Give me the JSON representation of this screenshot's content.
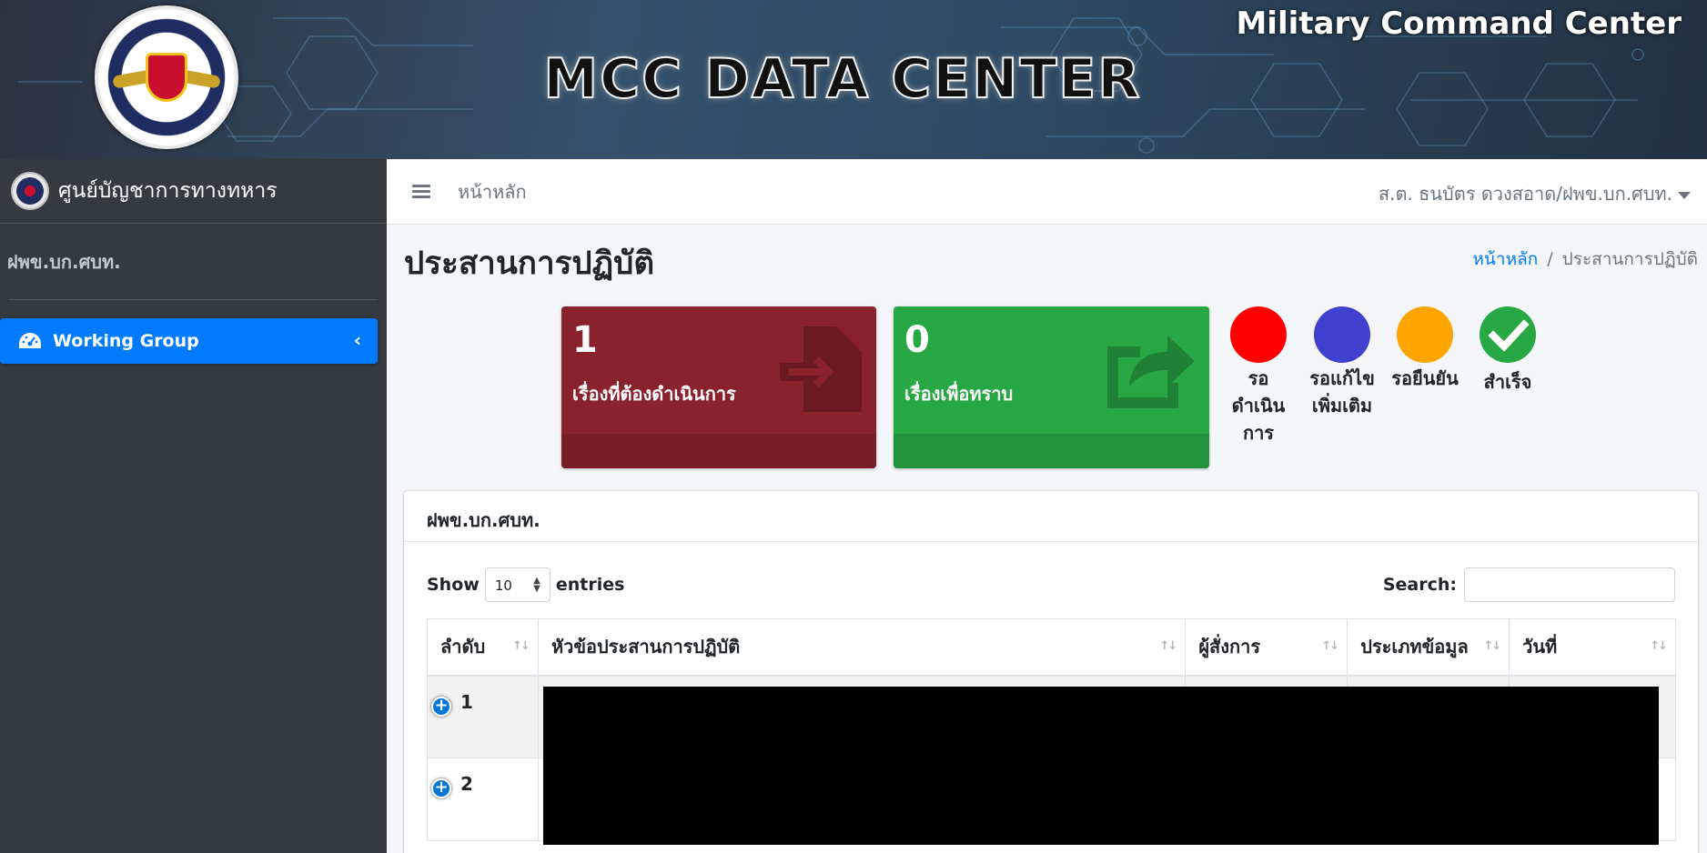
{
  "banner": {
    "title": "MCC DATA CENTER",
    "subtitle": "Military Command Center",
    "logo_icon": "military-command-center-seal"
  },
  "sidebar": {
    "brand_text": "ศูนย์บัญชาการทางทหาร",
    "user_unit": "ฝพข.บก.ศบท.",
    "nav": [
      {
        "label": "Working Group",
        "icon": "tachometer-icon",
        "active": true
      }
    ]
  },
  "topnav": {
    "home_link": "หน้าหลัก",
    "user_name": "ส.ต. ธนบัตร ดวงสอาด/ฝพข.บก.ศบท."
  },
  "page": {
    "title": "ประสานการปฏิบัติ",
    "breadcrumb": {
      "home": "หน้าหลัก",
      "current": "ประสานการปฏิบัติ",
      "separator": "/"
    }
  },
  "stats": [
    {
      "count": "1",
      "label": "เรื่องที่ต้องดำเนินการ",
      "color": "#8a222e",
      "icon": "file-import-icon"
    },
    {
      "count": "0",
      "label": "เรื่องเพื่อทราบ",
      "color": "#28a745",
      "icon": "share-icon"
    }
  ],
  "legend": [
    {
      "color": "#ff0000",
      "line1": "รอ",
      "line2": "ดำเนิน",
      "line3": "การ"
    },
    {
      "color": "#4040cf",
      "line1": "รอแก้ไข",
      "line2": "เพิ่มเติม",
      "line3": ""
    },
    {
      "color": "#ffa500",
      "line1": "รอยืนยัน",
      "line2": "",
      "line3": ""
    },
    {
      "color": "#28a745",
      "line1": "สำเร็จ",
      "line2": "",
      "line3": "",
      "icon": "check-icon"
    }
  ],
  "card": {
    "title": "ฝพข.บก.ศบท.",
    "show_label": "Show",
    "entries_value": "10",
    "entries_label": "entries",
    "search_label": "Search:",
    "search_value": "",
    "columns": [
      "ลำดับ",
      "หัวข้อประสานการปฏิบัติ",
      "ผู้สั่งการ",
      "ประเภทข้อมูล",
      "วันที่"
    ],
    "rows": [
      {
        "no": "1"
      },
      {
        "no": "2"
      }
    ]
  }
}
